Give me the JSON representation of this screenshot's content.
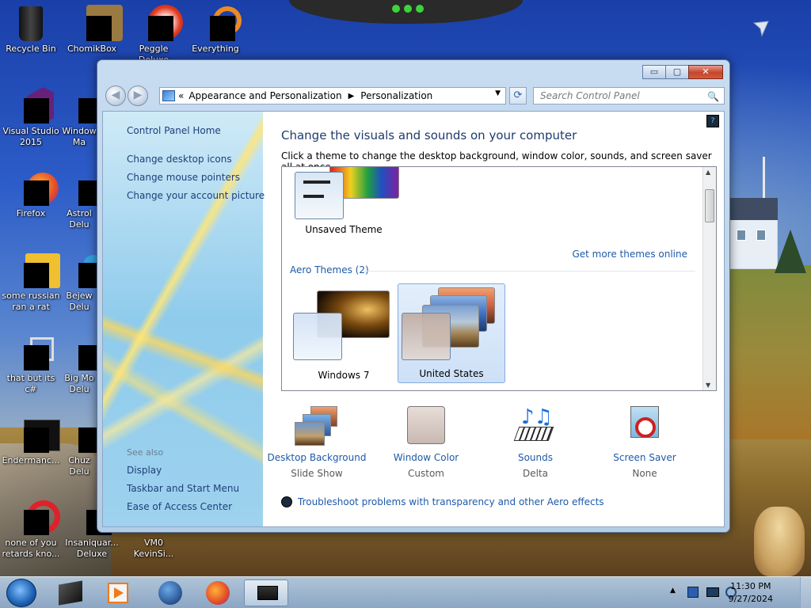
{
  "desktop": {
    "icons": [
      {
        "label": "Recycle Bin"
      },
      {
        "label": "ChomikBox"
      },
      {
        "label": "Peggle Deluxe"
      },
      {
        "label": "Everything"
      },
      {
        "label": "Visual Studio\n2015"
      },
      {
        "label": "Window\nMa"
      },
      {
        "label": "Firefox"
      },
      {
        "label": "Astrol\nDelu"
      },
      {
        "label": "some russian\nran a rat"
      },
      {
        "label": "Bejew\nDelu"
      },
      {
        "label": "that but its c#"
      },
      {
        "label": "Big Mo\nDelu"
      },
      {
        "label": "Endermanc..."
      },
      {
        "label": "Chuz\nDelu"
      },
      {
        "label": "none of you\nretards kno..."
      },
      {
        "label": "Insaniquar...\nDeluxe"
      },
      {
        "label": "VM0\nKevinSi..."
      }
    ]
  },
  "window": {
    "controls": {
      "minimize": "▭",
      "maximize": "▢",
      "close": "✕"
    },
    "nav": {
      "back": "◀",
      "forward": "▶"
    },
    "address": {
      "chevrons": "«",
      "crumb1": "Appearance and Personalization",
      "sep": "▶",
      "crumb2": "Personalization",
      "dropdown": "▼"
    },
    "refresh": "⟳",
    "search_placeholder": "Search Control Panel",
    "search_icon": "🔍",
    "left_pane": {
      "home": "Control Panel Home",
      "links": [
        "Change desktop icons",
        "Change mouse pointers",
        "Change your account picture"
      ],
      "see_also": "See also",
      "see_also_links": [
        "Display",
        "Taskbar and Start Menu",
        "Ease of Access Center"
      ]
    },
    "main": {
      "title": "Change the visuals and sounds on your computer",
      "subtitle": "Click a theme to change the desktop background, window color, sounds, and screen saver all at once.",
      "help_icon": "?",
      "themes_box": {
        "my_themes": [
          {
            "label": "Unsaved Theme"
          }
        ],
        "get_more": "Get more themes online",
        "aero_group": "Aero Themes (2)",
        "aero_themes": [
          {
            "label": "Windows 7",
            "selected": false
          },
          {
            "label": "United States",
            "selected": true
          }
        ]
      },
      "bottom": [
        {
          "title": "Desktop Background",
          "value": "Slide Show",
          "icon": "desktop-background-icon"
        },
        {
          "title": "Window Color",
          "value": "Custom",
          "icon": "window-color-icon"
        },
        {
          "title": "Sounds",
          "value": "Delta",
          "icon": "sounds-icon"
        },
        {
          "title": "Screen Saver",
          "value": "None",
          "icon": "screen-saver-icon"
        }
      ],
      "troubleshoot": "Troubleshoot problems with transparency and other Aero effects"
    }
  },
  "taskbar": {
    "clock_time": "11:30 PM",
    "clock_date": "9/27/2024",
    "tray_arrow": "▲"
  }
}
